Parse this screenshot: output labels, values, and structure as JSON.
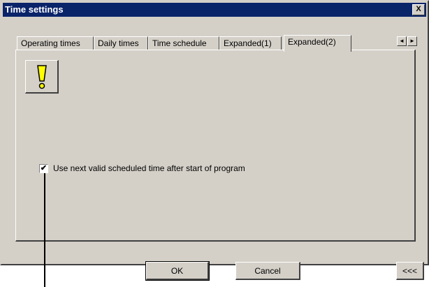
{
  "window": {
    "title": "Time settings",
    "close_label": "X"
  },
  "tabs": [
    {
      "label": "Operating times",
      "active": false
    },
    {
      "label": "Daily times",
      "active": false
    },
    {
      "label": "Time schedule",
      "active": false
    },
    {
      "label": "Expanded(1)",
      "active": false
    },
    {
      "label": "Expanded(2)",
      "active": true
    }
  ],
  "tab_scroll": {
    "left_label": "◄",
    "right_label": "►"
  },
  "panel": {
    "warning_icon": "exclamation-icon",
    "checkbox": {
      "checked": true,
      "check_mark": "✔",
      "label": "Use next valid scheduled time after start of program"
    }
  },
  "buttons": {
    "ok_label": "OK",
    "cancel_label": "Cancel",
    "collapse_label": "<<<"
  },
  "colors": {
    "titlebar": "#0a246a",
    "face": "#d4d0c8",
    "warning_fill": "#ffff00"
  }
}
